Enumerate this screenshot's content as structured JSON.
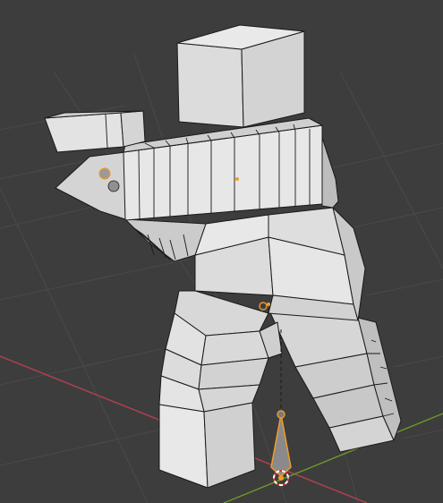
{
  "viewport": {
    "background": "#3d3d3d",
    "grid_color": "#4a4a4a",
    "x_axis_color": "#b8404e",
    "y_axis_color": "#6b9a2a"
  },
  "mesh": {
    "light": "#e2e2e2",
    "mid": "#cfcfcf",
    "shade": "#b9b9b9",
    "dark": "#a6a6a6",
    "wire": "#1a1a1a"
  },
  "selection": {
    "color": "#f29b2a"
  },
  "icons": {
    "bone": "bone-icon",
    "pivot": "origin-icon",
    "cursor": "3d-cursor-icon",
    "light": "light-icon"
  }
}
